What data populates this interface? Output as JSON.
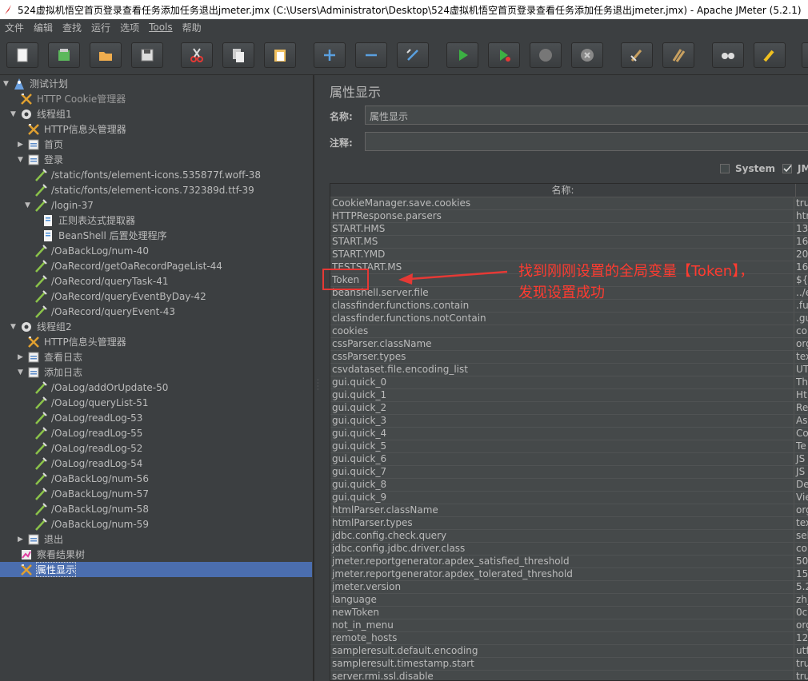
{
  "window": {
    "title": "524虚拟机悟空首页登录查看任务添加任务退出jmeter.jmx (C:\\Users\\Administrator\\Desktop\\524虚拟机悟空首页登录查看任务添加任务退出jmeter.jmx) - Apache JMeter (5.2.1)"
  },
  "menu": [
    "文件",
    "编辑",
    "查找",
    "运行",
    "选项",
    "Tools",
    "帮助"
  ],
  "toolbar": {
    "buttons": [
      "new-icon",
      "templates-icon",
      "open-icon",
      "save-icon",
      "cut-icon",
      "copy-icon",
      "paste-icon",
      "expand-icon",
      "collapse-icon",
      "toggle-icon",
      "start-icon",
      "start-no-pauses-icon",
      "stop-icon",
      "shutdown-icon",
      "clear-icon",
      "clear-all-icon",
      "search-icon",
      "reset-search-icon"
    ]
  },
  "tree": {
    "nodes": [
      {
        "label": "测试计划",
        "icon": "test-plan-icon",
        "toggle": "▼"
      },
      {
        "label": "HTTP Cookie管理器",
        "icon": "config-icon",
        "toggle": ""
      },
      {
        "label": "线程组1",
        "icon": "gear-icon",
        "toggle": "▼"
      },
      {
        "label": "HTTP信息头管理器",
        "icon": "config-icon",
        "toggle": ""
      },
      {
        "label": "首页",
        "icon": "controller-icon",
        "toggle": "▶"
      },
      {
        "label": "登录",
        "icon": "controller-icon",
        "toggle": "▼"
      },
      {
        "label": "/static/fonts/element-icons.535877f.woff-38",
        "icon": "sampler-icon",
        "toggle": ""
      },
      {
        "label": "/static/fonts/element-icons.732389d.ttf-39",
        "icon": "sampler-icon",
        "toggle": ""
      },
      {
        "label": "/login-37",
        "icon": "sampler-icon",
        "toggle": "▼"
      },
      {
        "label": "正则表达式提取器",
        "icon": "postprocessor-icon",
        "toggle": ""
      },
      {
        "label": "BeanShell 后置处理程序",
        "icon": "postprocessor-icon",
        "toggle": ""
      },
      {
        "label": "/OaBackLog/num-40",
        "icon": "sampler-icon",
        "toggle": ""
      },
      {
        "label": "/OaRecord/getOaRecordPageList-44",
        "icon": "sampler-icon",
        "toggle": ""
      },
      {
        "label": "/OaRecord/queryTask-41",
        "icon": "sampler-icon",
        "toggle": ""
      },
      {
        "label": "/OaRecord/queryEventByDay-42",
        "icon": "sampler-icon",
        "toggle": ""
      },
      {
        "label": "/OaRecord/queryEvent-43",
        "icon": "sampler-icon",
        "toggle": ""
      },
      {
        "label": "线程组2",
        "icon": "gear-icon",
        "toggle": "▼"
      },
      {
        "label": "HTTP信息头管理器",
        "icon": "config-icon",
        "toggle": ""
      },
      {
        "label": "查看日志",
        "icon": "controller-icon",
        "toggle": "▶"
      },
      {
        "label": "添加日志",
        "icon": "controller-icon",
        "toggle": "▼"
      },
      {
        "label": "/OaLog/addOrUpdate-50",
        "icon": "sampler-icon",
        "toggle": ""
      },
      {
        "label": "/OaLog/queryList-51",
        "icon": "sampler-icon",
        "toggle": ""
      },
      {
        "label": "/OaLog/readLog-53",
        "icon": "sampler-icon",
        "toggle": ""
      },
      {
        "label": "/OaLog/readLog-55",
        "icon": "sampler-icon",
        "toggle": ""
      },
      {
        "label": "/OaLog/readLog-52",
        "icon": "sampler-icon",
        "toggle": ""
      },
      {
        "label": "/OaLog/readLog-54",
        "icon": "sampler-icon",
        "toggle": ""
      },
      {
        "label": "/OaBackLog/num-56",
        "icon": "sampler-icon",
        "toggle": ""
      },
      {
        "label": "/OaBackLog/num-57",
        "icon": "sampler-icon",
        "toggle": ""
      },
      {
        "label": "/OaBackLog/num-58",
        "icon": "sampler-icon",
        "toggle": ""
      },
      {
        "label": "/OaBackLog/num-59",
        "icon": "sampler-icon",
        "toggle": ""
      },
      {
        "label": "退出",
        "icon": "controller-icon",
        "toggle": "▶"
      },
      {
        "label": "察看结果树",
        "icon": "listener-icon",
        "toggle": ""
      },
      {
        "label": "属性显示",
        "icon": "config-icon",
        "toggle": "",
        "selected": true
      }
    ]
  },
  "panel": {
    "title": "属性显示",
    "name_label": "名称:",
    "name_value": "属性显示",
    "comment_label": "注释:",
    "comment_value": "",
    "system_label": "System",
    "jmeter_label": "JM",
    "column_name": "名称:",
    "rows": [
      [
        "CookieManager.save.cookies",
        "tru"
      ],
      [
        "HTTPResponse.parsers",
        "htr"
      ],
      [
        "START.HMS",
        "13"
      ],
      [
        "START.MS",
        "16"
      ],
      [
        "START.YMD",
        "20"
      ],
      [
        "TESTSTART.MS",
        "16"
      ],
      [
        "Token",
        "${T"
      ],
      [
        "beanshell.server.file",
        "../e"
      ],
      [
        "classfinder.functions.contain",
        ".fu"
      ],
      [
        "classfinder.functions.notContain",
        ".gu"
      ],
      [
        "cookies",
        "co"
      ],
      [
        "cssParser.className",
        "org"
      ],
      [
        "cssParser.types",
        "tex"
      ],
      [
        "csvdataset.file.encoding_list",
        "UT"
      ],
      [
        "gui.quick_0",
        "Th"
      ],
      [
        "gui.quick_1",
        "Ht"
      ],
      [
        "gui.quick_2",
        "Re"
      ],
      [
        "gui.quick_3",
        "As"
      ],
      [
        "gui.quick_4",
        "Co"
      ],
      [
        "gui.quick_5",
        "Te"
      ],
      [
        "gui.quick_6",
        "JS"
      ],
      [
        "gui.quick_7",
        "JS"
      ],
      [
        "gui.quick_8",
        "De"
      ],
      [
        "gui.quick_9",
        "Vie"
      ],
      [
        "htmlParser.className",
        "org"
      ],
      [
        "htmlParser.types",
        "tex"
      ],
      [
        "jdbc.config.check.query",
        "sel"
      ],
      [
        "jdbc.config.jdbc.driver.class",
        "co"
      ],
      [
        "jmeter.reportgenerator.apdex_satisfied_threshold",
        "50"
      ],
      [
        "jmeter.reportgenerator.apdex_tolerated_threshold",
        "15"
      ],
      [
        "jmeter.version",
        "5.2"
      ],
      [
        "language",
        "zh_"
      ],
      [
        "newToken",
        "0c"
      ],
      [
        "not_in_menu",
        "org"
      ],
      [
        "remote_hosts",
        "12"
      ],
      [
        "sampleresult.default.encoding",
        "utf-"
      ],
      [
        "sampleresult.timestamp.start",
        "tru"
      ],
      [
        "server.rmi.ssl.disable",
        "tru"
      ]
    ]
  },
  "annotation": {
    "line1": "找到刚刚设置的全局变量【Token】，",
    "line2": "发现设置成功",
    "color": "#ff3b30"
  }
}
